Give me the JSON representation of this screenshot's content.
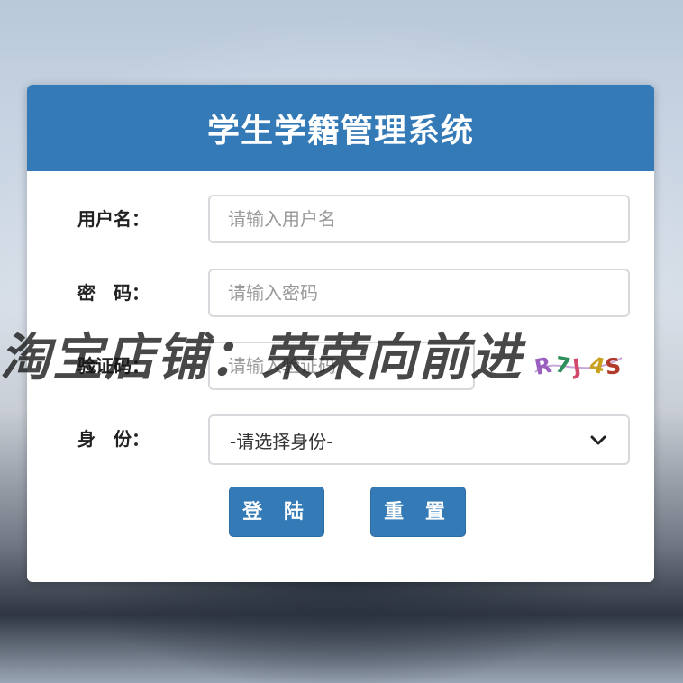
{
  "login": {
    "title": "学生学籍管理系统",
    "username_label": "用户名：",
    "username_placeholder": "请输入用户名",
    "password_label": "密　码：",
    "password_placeholder": "请输入密码",
    "captcha_label": "验证码：",
    "captcha_placeholder": "请输入验证码",
    "captcha_text": "R7J4S",
    "role_label": "身　份：",
    "role_selected": "-请选择身份-",
    "login_button": "登 陆",
    "reset_button": "重 置"
  },
  "watermark": {
    "text": "淘宝店铺：荣荣向前进"
  },
  "colors": {
    "header_bg": "#337ab7",
    "button_bg": "#337ab7"
  },
  "icons": {
    "select_arrow": "chevron-down-icon"
  }
}
